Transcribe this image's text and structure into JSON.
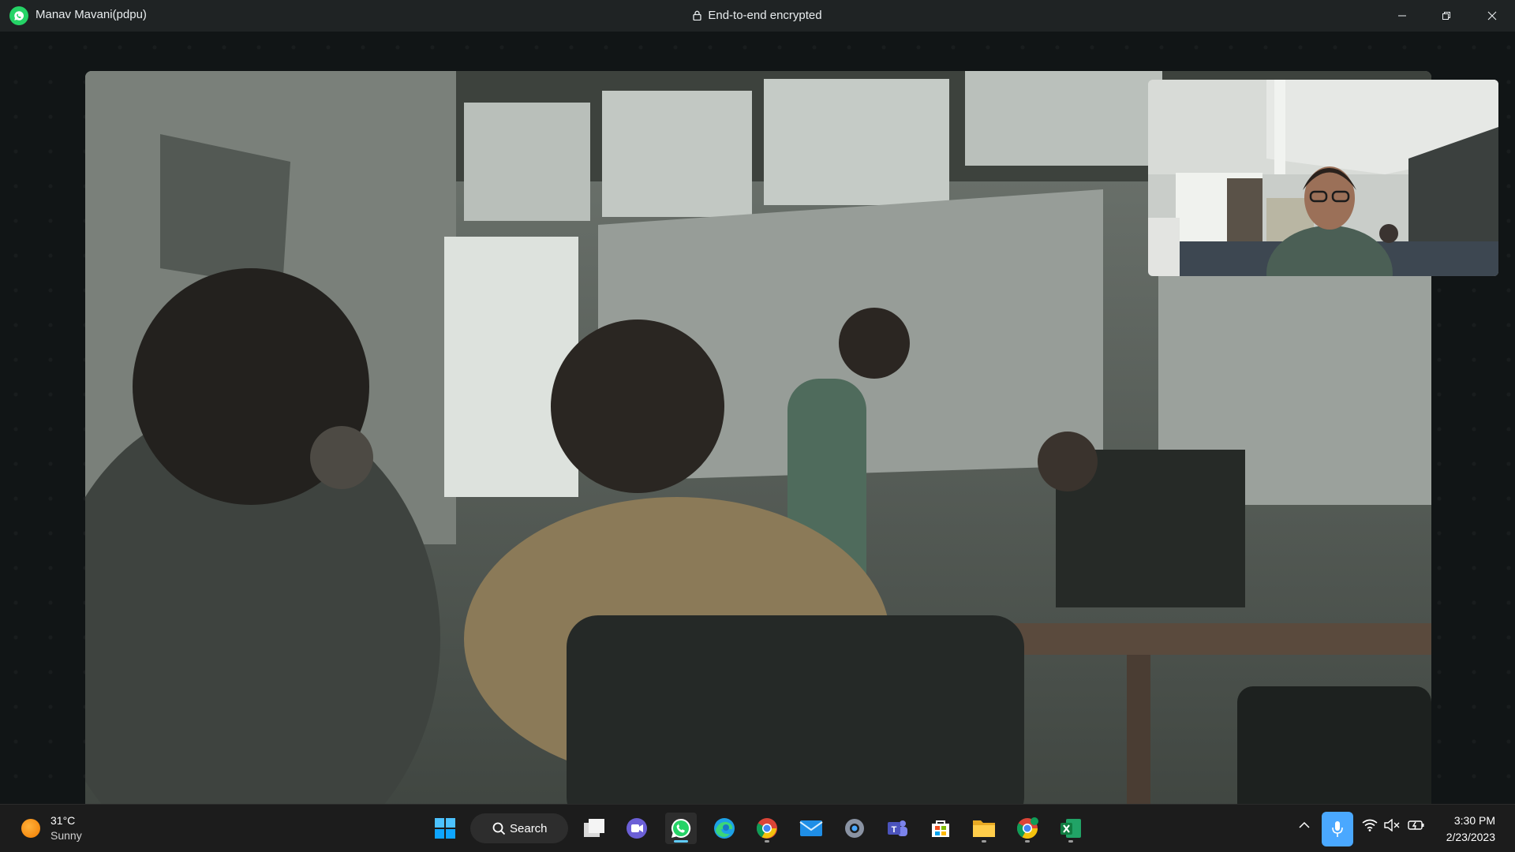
{
  "window": {
    "contact_name": "Manav Mavani(pdpu)",
    "encryption_text": "End-to-end encrypted",
    "controls": [
      "minimize-icon",
      "restore-icon",
      "close-icon"
    ]
  },
  "call": {
    "remote_video": "remote-participant-video",
    "self_video": "self-preview-video"
  },
  "taskbar": {
    "weather": {
      "temp": "31°C",
      "condition": "Sunny",
      "icon": "sun-icon"
    },
    "search_label": "Search",
    "apps": [
      "windows-start-icon",
      "task-view-icon",
      "meet-now-icon",
      "whatsapp-icon",
      "edge-icon",
      "chrome-icon",
      "mail-icon",
      "settings-icon",
      "teams-icon",
      "store-icon",
      "file-explorer-icon",
      "chrome-profile-icon",
      "excel-icon"
    ],
    "active_app": "whatsapp-icon",
    "tray": {
      "mic": "microphone-icon",
      "wifi": "wifi-icon",
      "volume": "volume-muted-icon",
      "battery": "battery-icon"
    },
    "time": "3:30 PM",
    "date": "2/23/2023"
  },
  "colors": {
    "accent": "#25d366",
    "taskbar_accent": "#60cdff",
    "mic_active": "#4aa8ff"
  }
}
